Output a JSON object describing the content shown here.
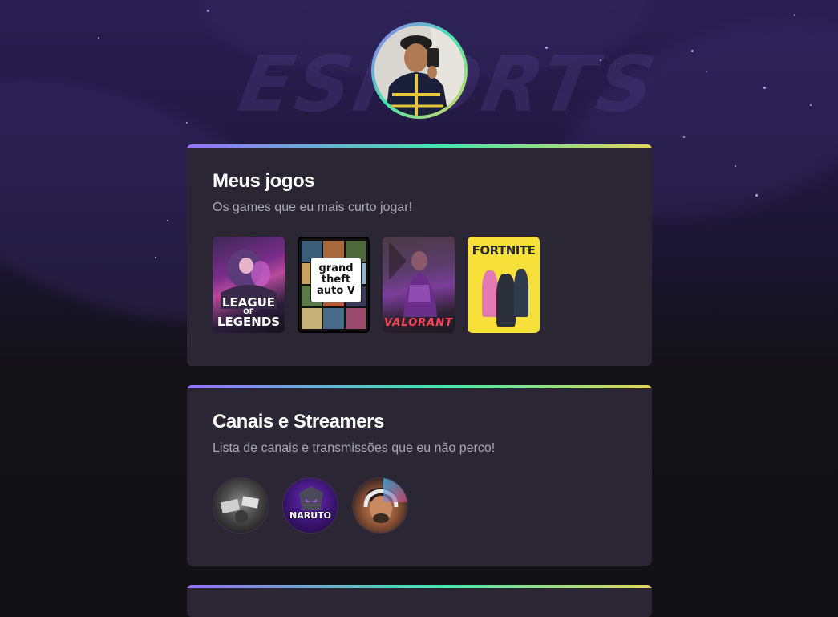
{
  "background": {
    "watermark_text": "ESPORTS"
  },
  "profile": {
    "avatar_icon": "profile-photo"
  },
  "games_card": {
    "title": "Meus jogos",
    "subtitle": "Os games que eu mais curto jogar!",
    "games": [
      {
        "name": "League of Legends",
        "logo_line1": "LEAGUE",
        "logo_line2": "OF",
        "logo_line3": "LEGENDS"
      },
      {
        "name": "Grand Theft Auto V",
        "logo_line1": "grand",
        "logo_line2": "theft",
        "logo_line3": "auto V"
      },
      {
        "name": "Valorant",
        "logo_line1": "VALORANT"
      },
      {
        "name": "Fortnite",
        "logo_line1": "FORTNITE"
      }
    ]
  },
  "channels_card": {
    "title": "Canais e Streamers",
    "subtitle": "Lista de canais e transmissões que eu não perco!",
    "channels": [
      {
        "label": ""
      },
      {
        "label": "NARUTO"
      },
      {
        "label": ""
      }
    ]
  },
  "colors": {
    "accent_gradient": [
      "#9572fc",
      "#43e7ad",
      "#e2d45c"
    ],
    "card_background": "#2a2634",
    "page_background": "#121214"
  }
}
